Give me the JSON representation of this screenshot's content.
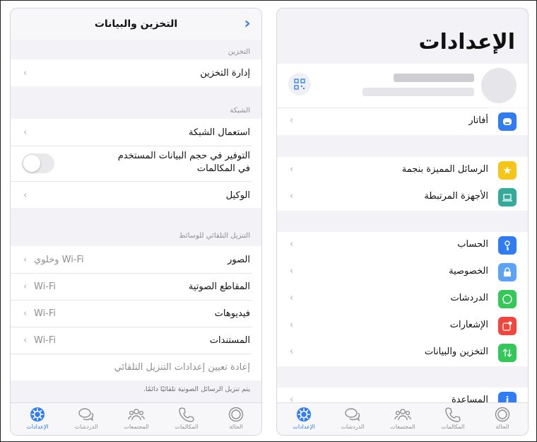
{
  "left": {
    "nav_title": "التخزين والبيانات",
    "storage_header": "التخزين",
    "manage_storage": "إدارة التخزين",
    "network_header": "الشبكة",
    "network_usage": "استعمال الشبكة",
    "save_data_line1": "التوفير في حجم البيانات المستخدم",
    "save_data_line2": "في المكالمات",
    "proxy": "الوكيل",
    "auto_download_header": "التنزيل التلقائي للوسائط",
    "photos": "الصور",
    "photos_value": "Wi-Fi وخلوي",
    "audio": "المقاطع الصوتية",
    "audio_value": "Wi-Fi",
    "videos": "فيديوهات",
    "videos_value": "Wi-Fi",
    "documents": "المستندات",
    "documents_value": "Wi-Fi",
    "reset_auto_download": "إعادة تعيين إعدادات التنزيل التلقائي",
    "footnote": "يتم تنزيل الرسائل الصوتية تلقائيًا دائمًا.",
    "save_data_toggle": "off"
  },
  "right": {
    "title": "الإعدادات",
    "avatar_row": "أفاتار",
    "starred": "الرسائل المميزة بنجمة",
    "linked_devices": "الأجهزة المرتبطة",
    "account": "الحساب",
    "privacy": "الخصوصية",
    "chats": "الدردشات",
    "notifications": "الإشعارات",
    "storage_data": "التخزين والبيانات",
    "help": "المساعدة"
  },
  "tabs": {
    "status": "الحالة",
    "calls": "المكالمات",
    "communities": "المجتمعات",
    "chats": "الدردشات",
    "settings": "الإعدادات"
  },
  "colors": {
    "accent": "#2f7cf6",
    "avatar_tile": "#2f7cf6",
    "starred_tile": "#f5c518",
    "linked_tile": "#35a99a",
    "account_tile": "#2f7cf6",
    "privacy_tile": "#5aa3f5",
    "chats_tile": "#34c759",
    "notifications_tile": "#f2453d",
    "storage_tile": "#34c759",
    "help_tile": "#2f7cf6"
  }
}
